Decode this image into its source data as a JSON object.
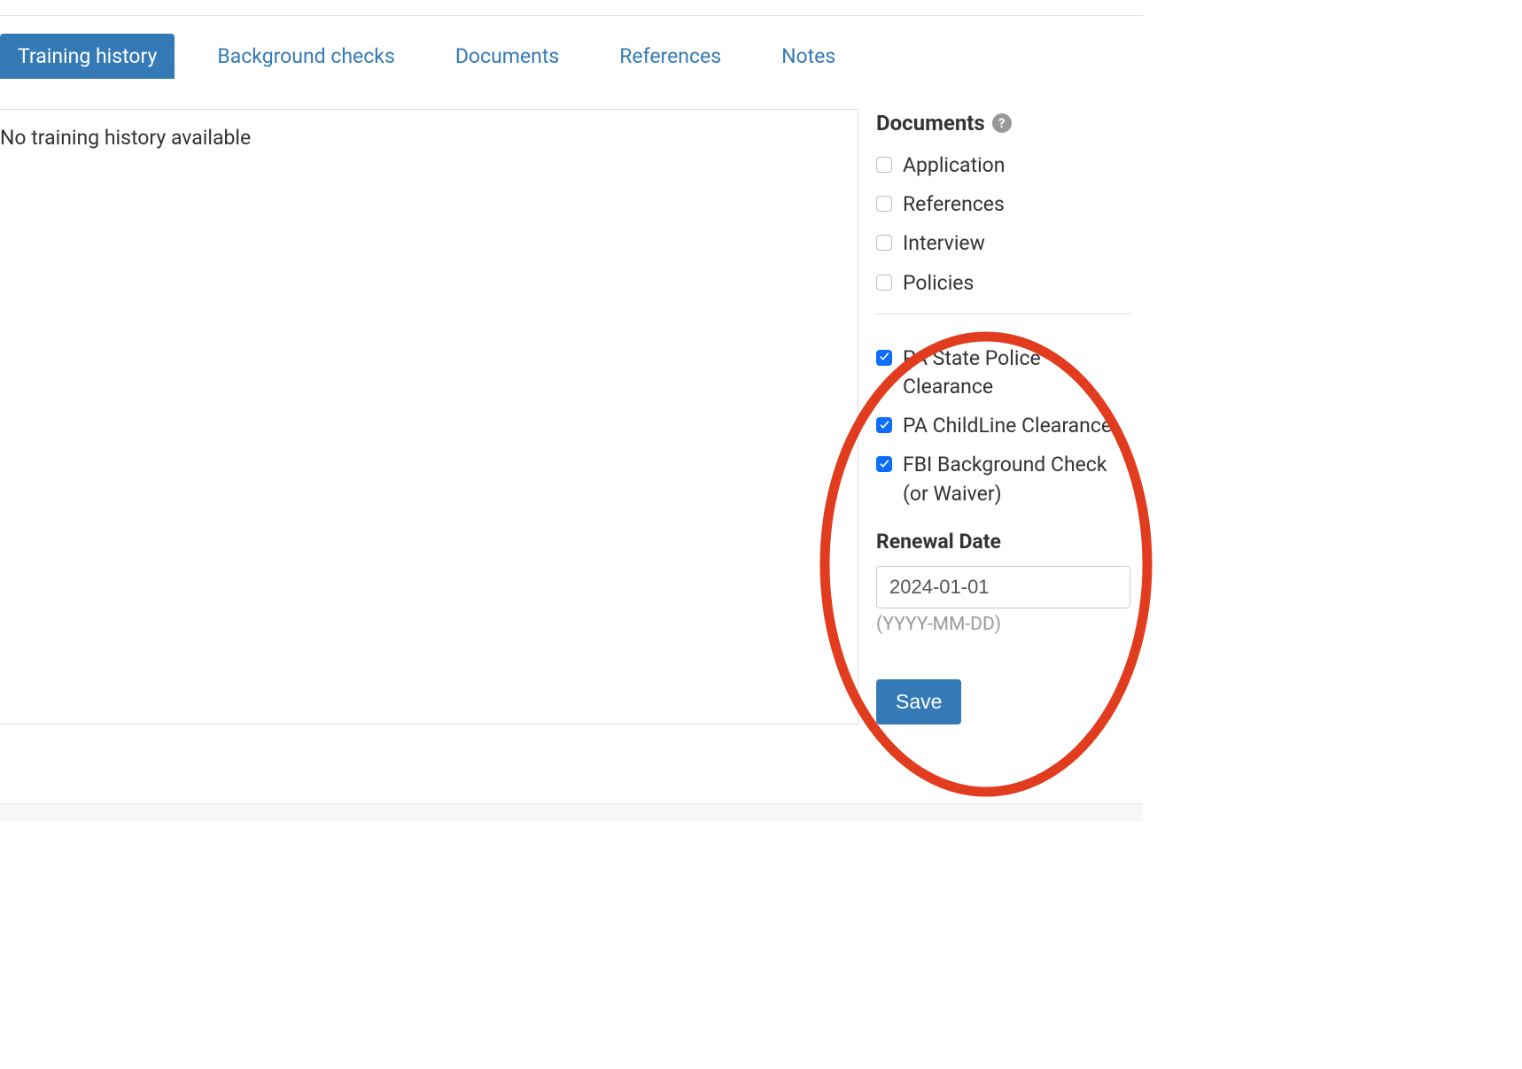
{
  "tabs": [
    {
      "label": "Training history",
      "active": true
    },
    {
      "label": "Background checks",
      "active": false
    },
    {
      "label": "Documents",
      "active": false
    },
    {
      "label": "References",
      "active": false
    },
    {
      "label": "Notes",
      "active": false
    }
  ],
  "main": {
    "empty_message": "No training history available"
  },
  "sidebar": {
    "heading": "Documents",
    "help_glyph": "?",
    "checklist_top": [
      {
        "label": "Application",
        "checked": false
      },
      {
        "label": "References",
        "checked": false
      },
      {
        "label": "Interview",
        "checked": false
      },
      {
        "label": "Policies",
        "checked": false
      }
    ],
    "checklist_bottom": [
      {
        "label": "PA State Police Clearance",
        "checked": true
      },
      {
        "label": "PA ChildLine Clearance",
        "checked": true
      },
      {
        "label": "FBI Background Check (or Waiver)",
        "checked": true
      }
    ],
    "renewal": {
      "heading": "Renewal Date",
      "value": "2024-01-01",
      "hint": "(YYYY-MM-DD)"
    },
    "save_label": "Save"
  }
}
